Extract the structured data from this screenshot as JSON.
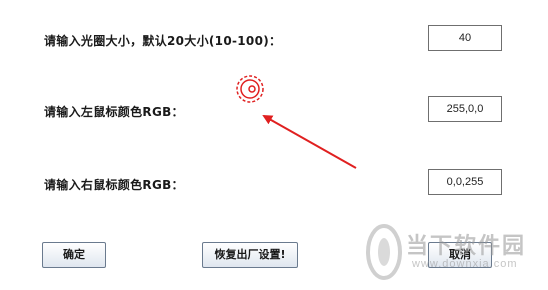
{
  "form": {
    "size_label": "请输入光圈大小，默认20大小(10-100)：",
    "size_value": "40",
    "left_color_label": "请输入左鼠标颜色RGB：",
    "left_color_value": "255,0,0",
    "right_color_label": "请输入右鼠标颜色RGB：",
    "right_color_value": "0,0,255"
  },
  "buttons": {
    "confirm": "确定",
    "restore": "恢复出厂设置!",
    "cancel": "取消"
  },
  "annotation": {
    "color": "#e02020"
  },
  "watermark": {
    "name": "当下软件园",
    "url": "www.downxia.com"
  }
}
